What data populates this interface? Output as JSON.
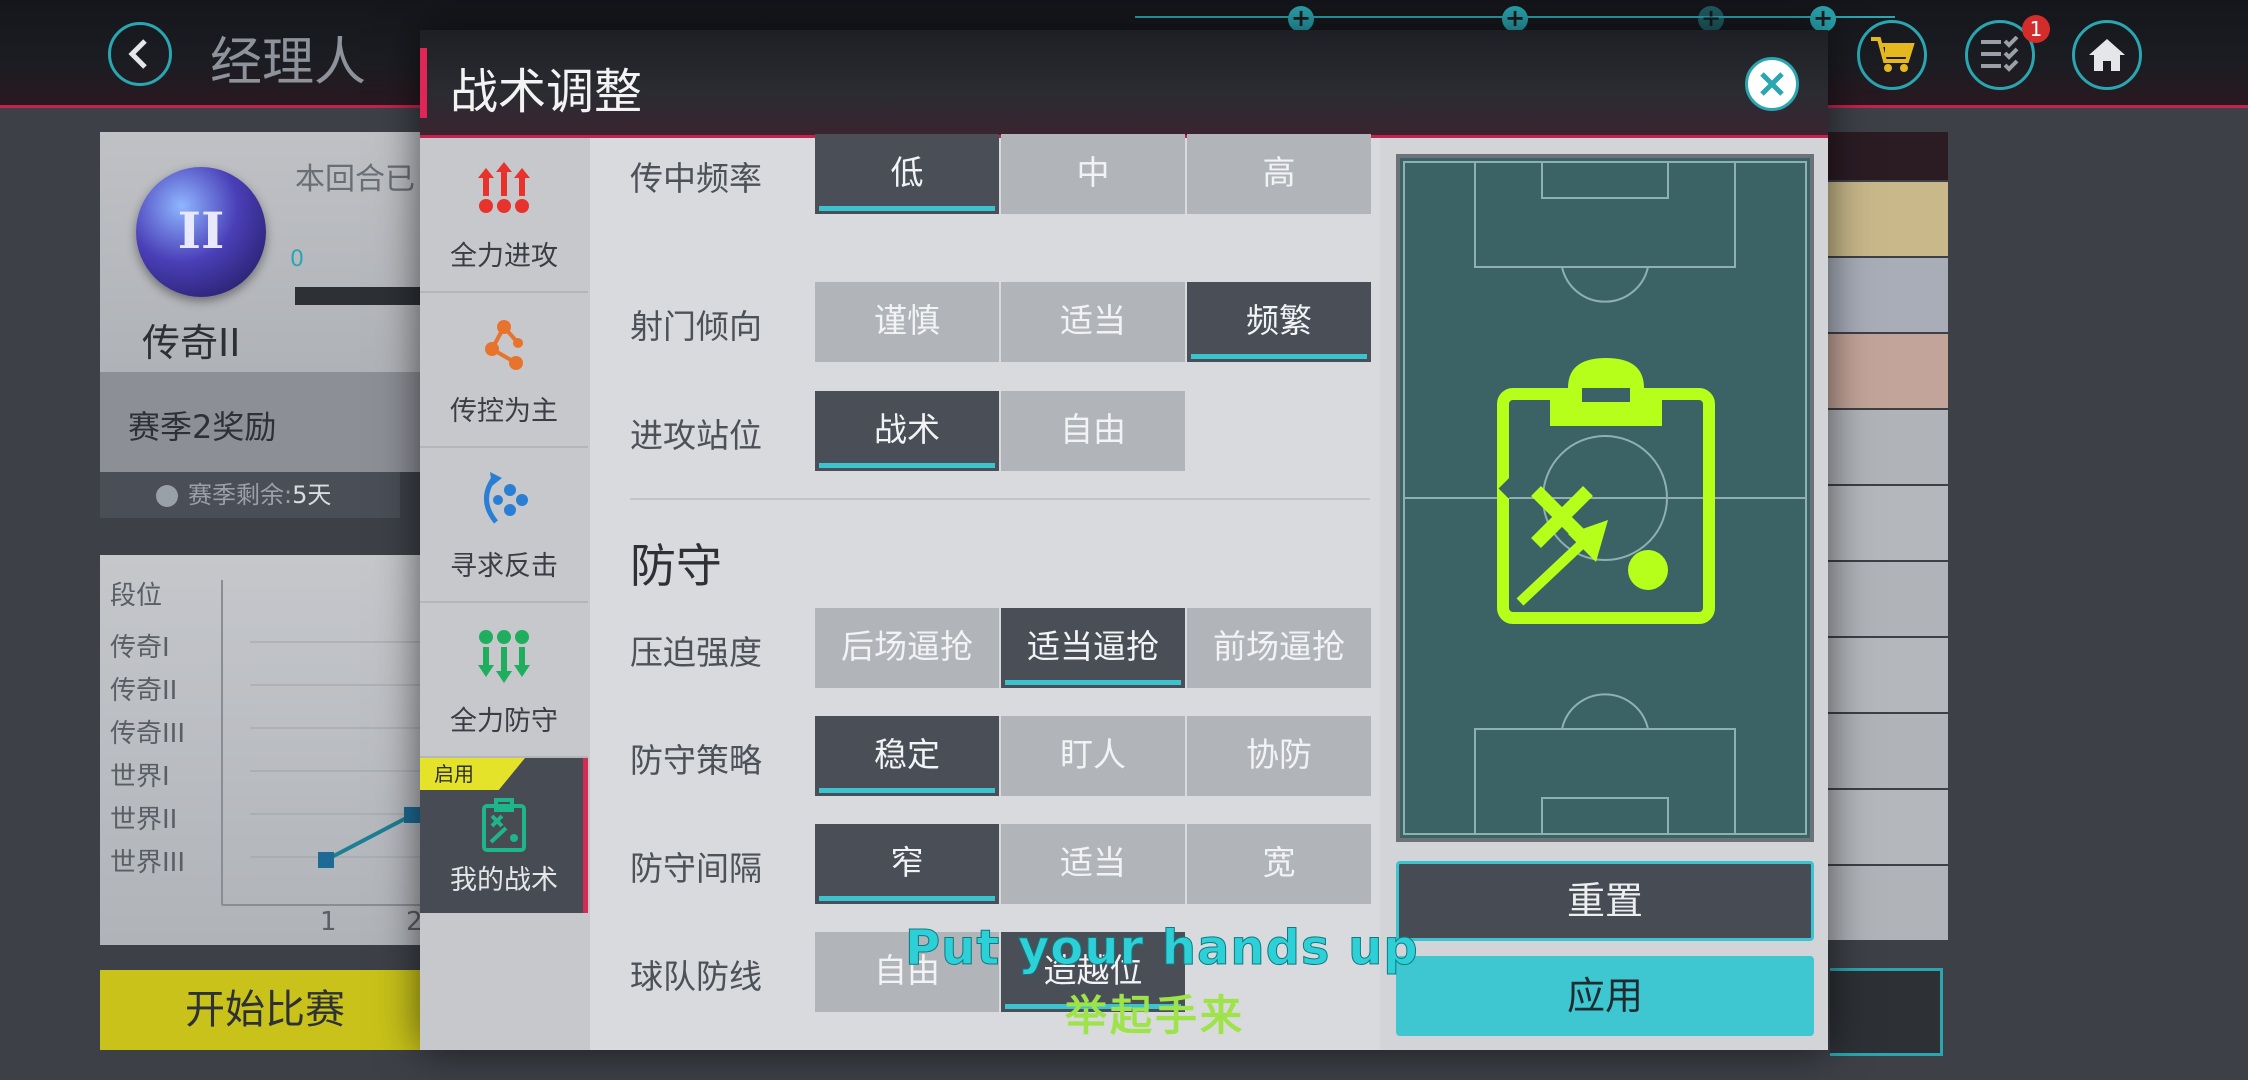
{
  "background": {
    "title": "经理人",
    "badge_count": "1",
    "league_name": "传奇II",
    "ball_label": "II",
    "round_text": "本回合已",
    "progress_start": "0",
    "season_reward": "赛季2奖励",
    "season_remaining_label": "赛季剩余:",
    "season_remaining_value": "5天",
    "chart": {
      "axis_title": "段位",
      "levels": [
        "传奇I",
        "传奇II",
        "传奇III",
        "世界I",
        "世界II",
        "世界III"
      ],
      "x_ticks": [
        "1",
        "2"
      ]
    },
    "start_button": "开始比赛",
    "right_colors": [
      "#c8b88a",
      "#a8adb8",
      "#c2a49a",
      "#b0b3b8",
      "#b4b7bc",
      "#b0b3b8",
      "#b4b7bc",
      "#b0b3b8",
      "#b4b7bc",
      "#b0b3b8"
    ]
  },
  "modal": {
    "title": "战术调整",
    "sidebar": [
      {
        "label": "全力进攻",
        "icon": "attack-arrows-icon"
      },
      {
        "label": "传控为主",
        "icon": "passing-network-icon"
      },
      {
        "label": "寻求反击",
        "icon": "counter-attack-icon"
      },
      {
        "label": "全力防守",
        "icon": "defense-arrows-icon"
      },
      {
        "label": "我的战术",
        "icon": "tactics-board-icon",
        "tag": "启用",
        "active": true
      }
    ],
    "rows": [
      {
        "label": "传中频率",
        "options": [
          "低",
          "中",
          "高"
        ],
        "selected": 0
      },
      {
        "label": "射门倾向",
        "options": [
          "谨慎",
          "适当",
          "频繁"
        ],
        "selected": 2
      },
      {
        "label": "进攻站位",
        "options": [
          "战术",
          "自由"
        ],
        "selected": 0
      }
    ],
    "defense_title": "防守",
    "defense_rows": [
      {
        "label": "压迫强度",
        "options": [
          "后场逼抢",
          "适当逼抢",
          "前场逼抢"
        ],
        "selected": 1
      },
      {
        "label": "防守策略",
        "options": [
          "稳定",
          "盯人",
          "协防"
        ],
        "selected": 0
      },
      {
        "label": "防守间隔",
        "options": [
          "窄",
          "适当",
          "宽"
        ],
        "selected": 0
      },
      {
        "label": "球队防线",
        "options": [
          "自由",
          "造越位"
        ],
        "selected": 1
      }
    ],
    "reset_button": "重置",
    "apply_button": "应用"
  },
  "subtitles": {
    "english": "Put your hands up",
    "chinese": "举起手来"
  },
  "colors": {
    "accent_cyan": "#3bc4cf",
    "accent_red": "#d42b56",
    "selected_option": "#4a4e57",
    "pitch_green": "#3b6265",
    "tactics_icon_lime": "#b6ff1a"
  }
}
